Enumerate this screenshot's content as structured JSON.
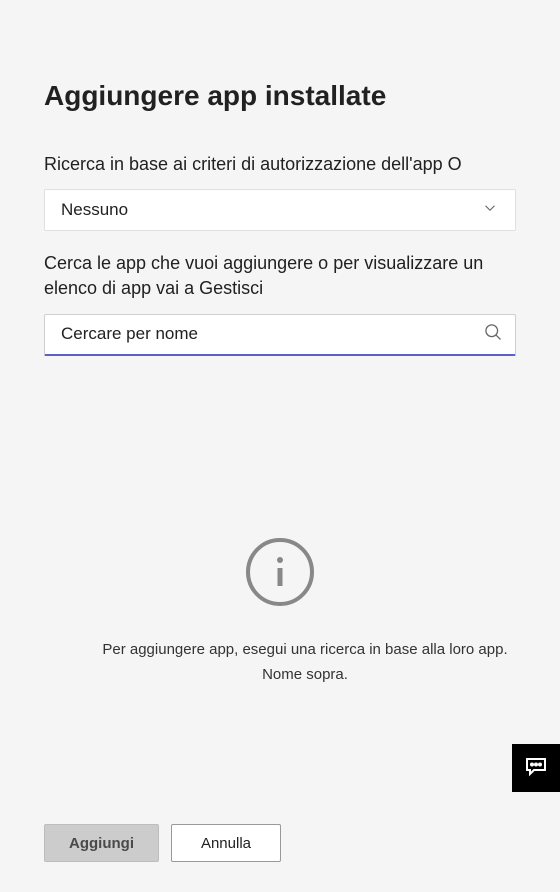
{
  "title": "Aggiungere app installate",
  "permissionPolicy": {
    "label": "Ricerca in base ai criteri di autorizzazione dell'app O",
    "selectedValue": "Nessuno"
  },
  "searchSection": {
    "label": "Cerca le app che vuoi aggiungere o per visualizzare un elenco di app vai a Gestisci",
    "placeholder": "Cercare per nome"
  },
  "emptyState": {
    "message": "Per aggiungere app, esegui una ricerca in base alla loro app. Nome sopra."
  },
  "buttons": {
    "add": "Aggiungi",
    "cancel": "Annulla"
  }
}
